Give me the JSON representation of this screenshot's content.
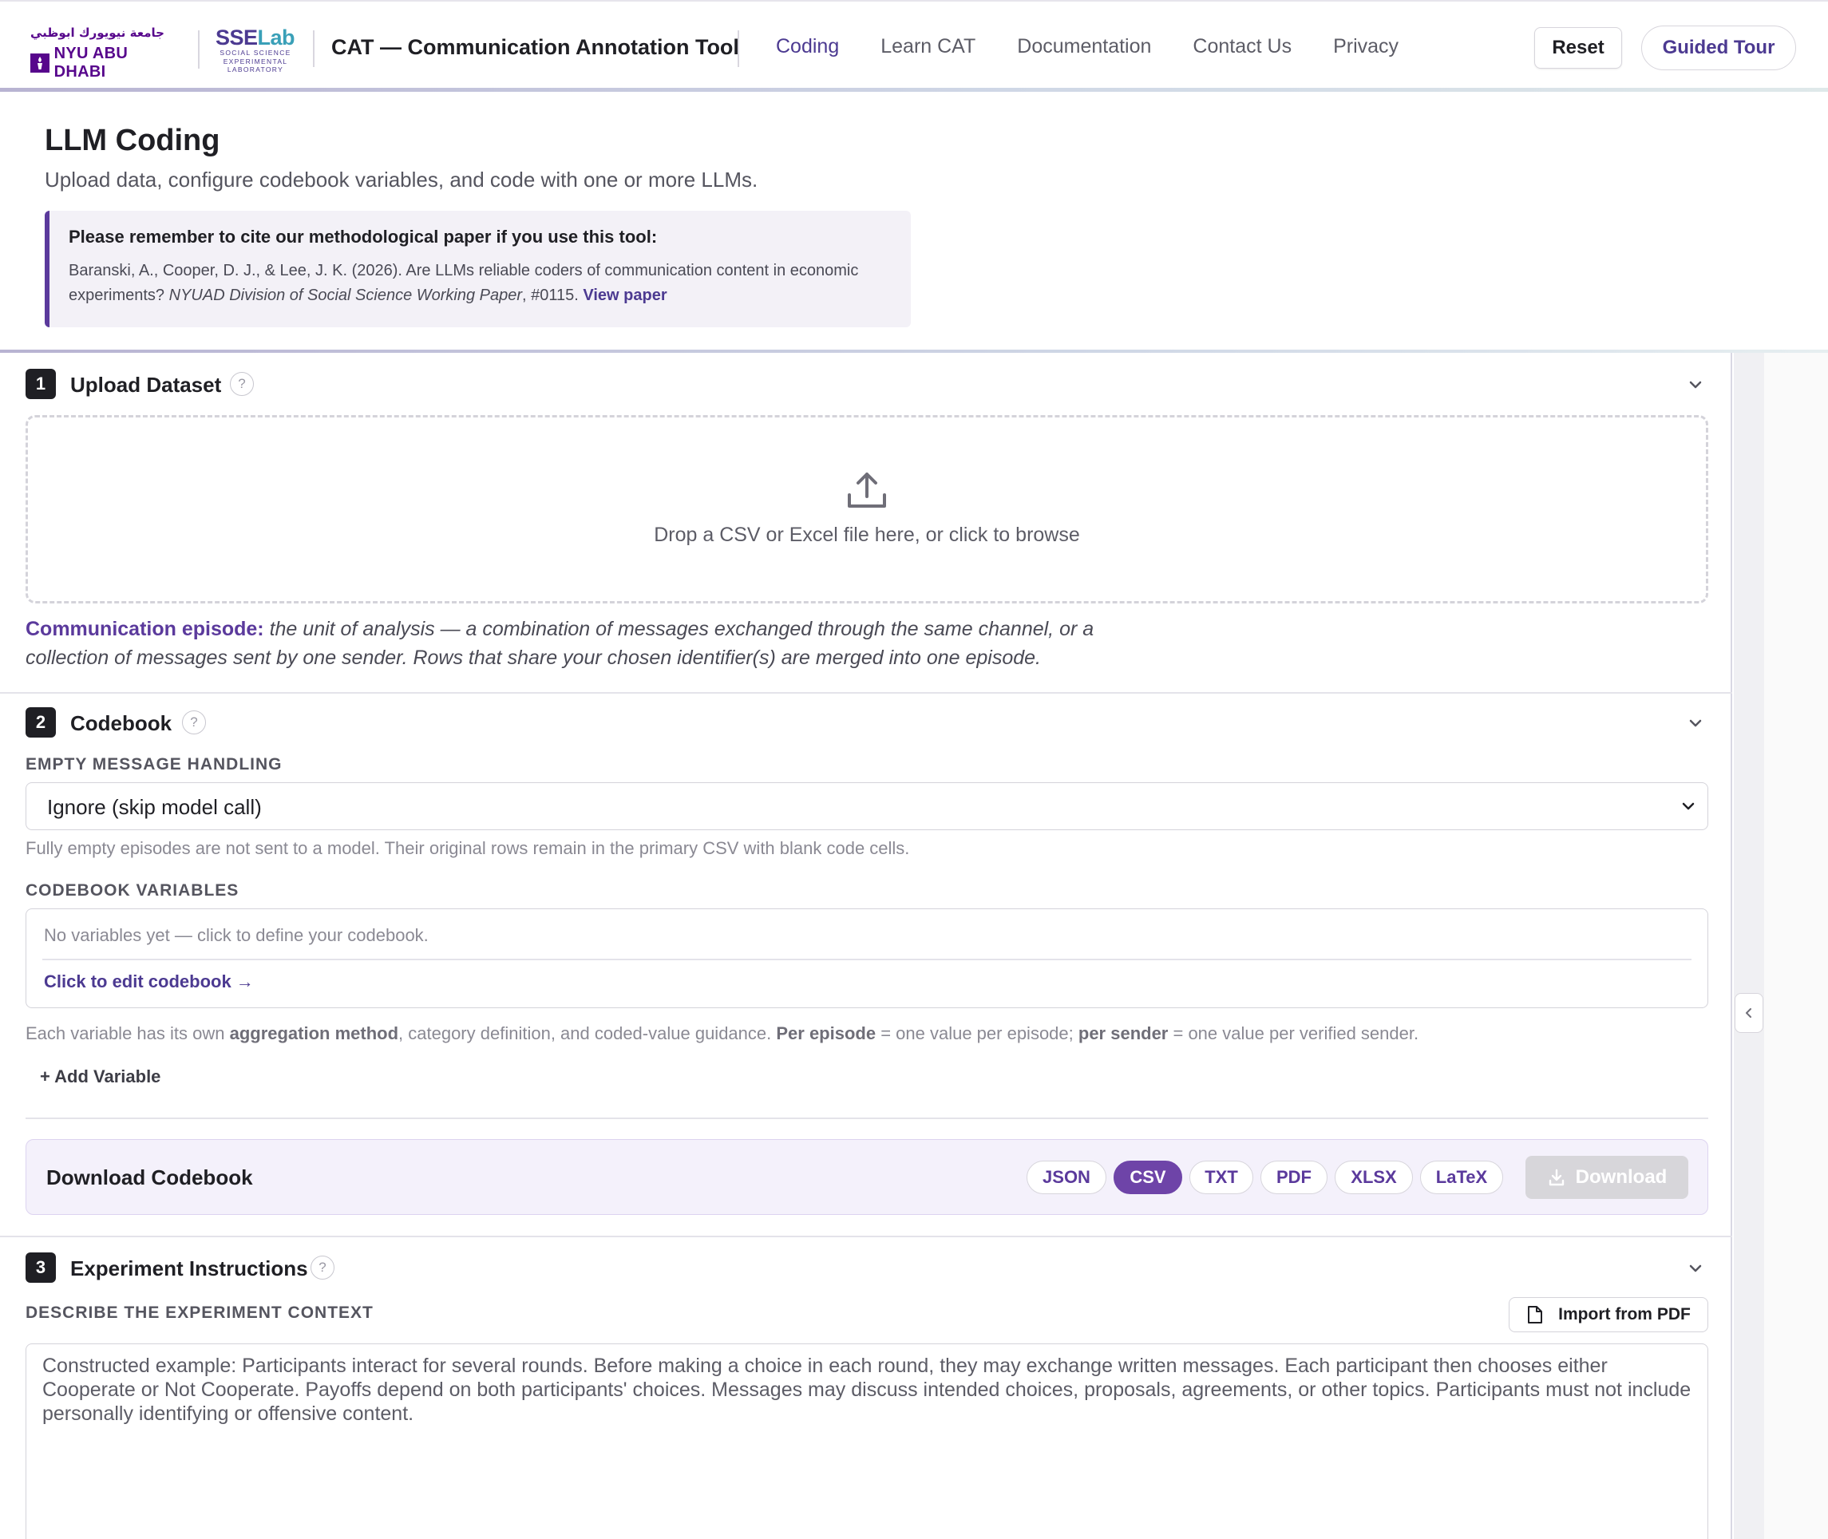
{
  "header": {
    "nyu_arabic": "جامعة نيويورك ابوظبي",
    "nyu_name": "NYU ABU DHABI",
    "sse_logo_a": "SSE",
    "sse_logo_b": "Lab",
    "sse_sub_1": "SOCIAL SCIENCE",
    "sse_sub_2": "EXPERIMENTAL",
    "sse_sub_3": "LABORATORY",
    "app_title": "CAT — Communication Annotation Tool",
    "nav": [
      "Coding",
      "Learn CAT",
      "Documentation",
      "Contact Us",
      "Privacy"
    ],
    "active_nav": "Coding",
    "reset_label": "Reset",
    "tour_label": "Guided Tour"
  },
  "intro": {
    "title": "LLM Coding",
    "subtitle": "Upload data, configure codebook variables, and code with one or more LLMs.",
    "cite_title": "Please remember to cite our methodological paper if you use this tool:",
    "cite_authors": "Baranski, A., Cooper, D. J., & Lee, J. K. (2026). Are LLMs reliable coders of communication content in economic experiments? ",
    "cite_series": "NYUAD Division of Social Science Working Paper",
    "cite_number": ", #0115. ",
    "cite_link": "View paper"
  },
  "upload": {
    "step": "1",
    "title": "Upload Dataset",
    "help": "?",
    "drop_text": "Drop a CSV or Excel file here, or click to browse",
    "episode_term": "Communication episode:",
    "episode_desc": " the unit of analysis — a combination of messages exchanged through the same channel, or a collection of messages sent by one sender. Rows that share your chosen identifier(s) are merged into one episode."
  },
  "codebook": {
    "step": "2",
    "title": "Codebook",
    "help": "?",
    "empty_label": "EMPTY MESSAGE HANDLING",
    "empty_value": "Ignore (skip model call)",
    "empty_hint": "Fully empty episodes are not sent to a model. Their original rows remain in the primary CSV with blank code cells.",
    "vars_label": "CODEBOOK VARIABLES",
    "vars_empty": "No variables yet — click to define your codebook.",
    "vars_link": "Click to edit codebook →",
    "agg_1": "Each variable has its own ",
    "agg_2": "aggregation method",
    "agg_3": ", category definition, and coded-value guidance. ",
    "agg_4": "Per episode",
    "agg_5": " = one value per episode; ",
    "agg_6": "per sender",
    "agg_7": " = one value per verified sender.",
    "add_var": "+ Add Variable",
    "download_title": "Download Codebook",
    "formats": [
      "JSON",
      "CSV",
      "TXT",
      "PDF",
      "XLSX",
      "LaTeX"
    ],
    "selected_format": "CSV",
    "download_label": "Download"
  },
  "experiment": {
    "step": "3",
    "title": "Experiment Instructions",
    "help": "?",
    "context_label": "DESCRIBE THE EXPERIMENT CONTEXT",
    "import_label": "Import from PDF",
    "context_text": "Constructed example: Participants interact for several rounds. Before making a choice in each round, they may exchange written messages. Each participant then chooses either Cooperate or Not Cooperate. Payoffs depend on both participants' choices. Messages may discuss intended choices, proposals, agreements, or other topics. Participants must not include personally identifying or offensive content."
  },
  "icons": {
    "upload": "upload-icon",
    "chevron": "chevron-down-icon",
    "collapse": "chevron-left-icon",
    "file": "file-icon",
    "download": "download-icon"
  },
  "colors": {
    "accent": "#5b3a9c",
    "active_pill": "#6e44a8",
    "nyu_purple": "#57068c"
  }
}
